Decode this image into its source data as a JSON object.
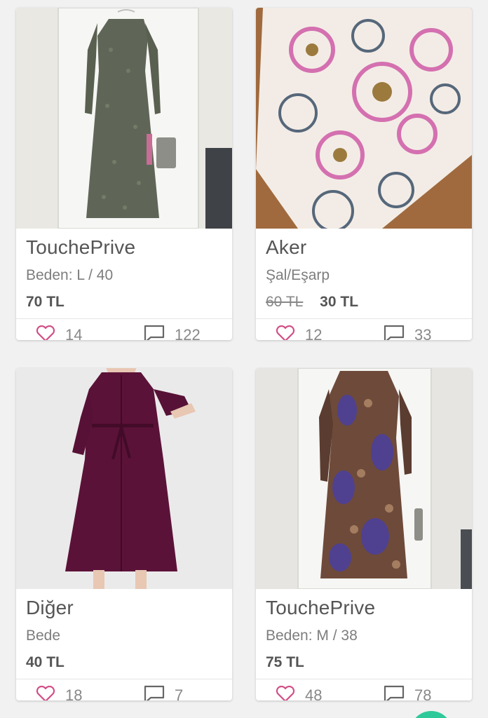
{
  "products": [
    {
      "brand": "TouchePrive",
      "subtitle": "Beden: L / 40",
      "old_price": "",
      "price": "70 TL",
      "likes": "14",
      "comments": "122",
      "image": "green-floral-maxi-dress-photo"
    },
    {
      "brand": "Aker",
      "subtitle": "Şal/Eşarp",
      "old_price": "60 TL",
      "price": "30 TL",
      "likes": "12",
      "comments": "33",
      "image": "pink-patterned-scarf-photo"
    },
    {
      "brand": "Diğer",
      "subtitle": "Bede",
      "old_price": "",
      "price": "40 TL",
      "likes": "18",
      "comments": "7",
      "image": "plum-shirt-dress-photo"
    },
    {
      "brand": "TouchePrive",
      "subtitle": "Beden: M / 38",
      "old_price": "",
      "price": "75 TL",
      "likes": "48",
      "comments": "78",
      "image": "brown-paisley-maxi-dress-photo"
    }
  ],
  "colors": {
    "accent": "#d14f86",
    "icon_gray": "#8a8a8a",
    "fab": "#2ec99a"
  },
  "icons": {
    "like": "heart-outline-icon",
    "comment": "speech-bubble-icon"
  }
}
